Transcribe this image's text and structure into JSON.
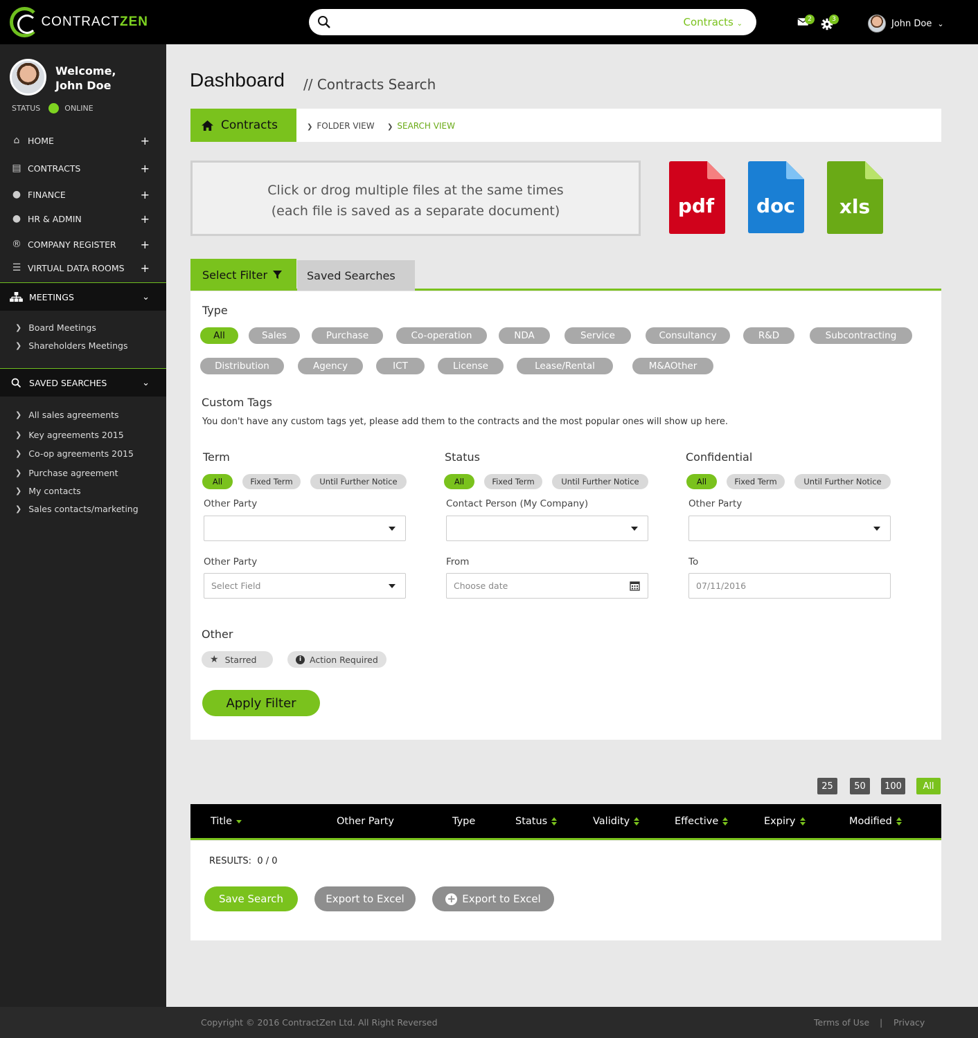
{
  "brand": {
    "name_light": "CONTRACT",
    "name_bold": "ZEN"
  },
  "topbar": {
    "search_scope": "Contracts",
    "mail_count": "2",
    "settings_count": "3",
    "user_name": "John Doe"
  },
  "sidebar": {
    "welcome": "Welcome,",
    "user_name": "John Doe",
    "status_label": "STATUS",
    "status_value": "ONLINE",
    "items": [
      {
        "label": "HOME",
        "icon": "home-icon"
      },
      {
        "label": "CONTRACTS",
        "icon": "document-icon"
      },
      {
        "label": "FINANCE",
        "icon": "user-icon"
      },
      {
        "label": "HR  & ADMIN",
        "icon": "users-icon"
      },
      {
        "label": "COMPANY REGISTER",
        "icon": "registered-icon"
      },
      {
        "label": "VIRTUAL DATA ROOMS",
        "icon": "database-icon"
      }
    ],
    "meetings": {
      "label": "MEETINGS",
      "items": [
        "Board Meetings",
        "Shareholders Meetings"
      ]
    },
    "saved_searches": {
      "label": "SAVED SEARCHES",
      "items": [
        "All sales agreements",
        "Key agreements 2015",
        "Co-op agreements 2015",
        "Purchase agreement",
        "My contacts",
        "Sales contacts/marketing"
      ]
    }
  },
  "page": {
    "title": "Dashboard",
    "subtitle": "// Contracts Search",
    "crumb_home": "Contracts",
    "crumb_folder": "FOLDER VIEW",
    "crumb_search": "SEARCH VIEW"
  },
  "dropzone": {
    "line1": "Click or drog multiple files at the same times",
    "line2": "(each file is saved as a separate document)"
  },
  "files": [
    {
      "label": "pdf",
      "color": "#d0021b",
      "fold": "#f58080"
    },
    {
      "label": "doc",
      "color": "#1a7fd4",
      "fold": "#7ec2f5"
    },
    {
      "label": "xls",
      "color": "#6aaa16",
      "fold": "#b9e36a"
    }
  ],
  "filters": {
    "tab_select": "Select Filter",
    "tab_saved": "Saved Searches",
    "type_heading": "Type",
    "types_row1": [
      "All",
      "Sales",
      "Purchase",
      "Co-operation",
      "NDA",
      "Service",
      "Consultancy",
      "R&D",
      "Subcontracting"
    ],
    "types_row2": [
      "Distribution",
      "Agency",
      "ICT",
      "License",
      "Lease/Rental",
      "M&AOther"
    ],
    "custom_heading": "Custom Tags",
    "custom_text": "You don't have any custom tags yet, please add them to the contracts and the most popular ones will show up here.",
    "columns": [
      {
        "heading": "Term",
        "pills": [
          "All",
          "Fixed Term",
          "Until Further Notice"
        ],
        "field1_label": "Other Party",
        "field1_value": "",
        "field2_label": "Other Party",
        "field2_value": "Select Field"
      },
      {
        "heading": "Status",
        "pills": [
          "All",
          "Fixed Term",
          "Until Further Notice"
        ],
        "field1_label": "Contact Person (My Company)",
        "field1_value": "",
        "field2_label": "From",
        "field2_value": "Choose date"
      },
      {
        "heading": "Confidential",
        "pills": [
          "All",
          "Fixed Term",
          "Until Further Notice"
        ],
        "field1_label": "Other Party",
        "field1_value": "",
        "field2_label": "To",
        "field2_value": "07/11/2016"
      }
    ],
    "other_heading": "Other",
    "other_starred": "Starred",
    "other_action": "Action Required",
    "apply": "Apply Filter"
  },
  "paging": [
    "25",
    "50",
    "100",
    "All"
  ],
  "table": {
    "columns": [
      "Title",
      "Other Party",
      "Type",
      "Status",
      "Validity",
      "Effective",
      "Expiry",
      "Modified"
    ],
    "results_label": "RESULTS:",
    "results_value": "0 / 0"
  },
  "actions": {
    "save": "Save Search",
    "export": "Export to Excel",
    "export_add": "Export to Excel"
  },
  "footer": {
    "copyright": "Copyright © 2016 ContractZen Ltd. All Right Reversed",
    "terms": "Terms of Use",
    "sep": "|",
    "privacy": "Privacy"
  },
  "colors": {
    "accent": "#7ac21d",
    "dark": "#222222"
  }
}
